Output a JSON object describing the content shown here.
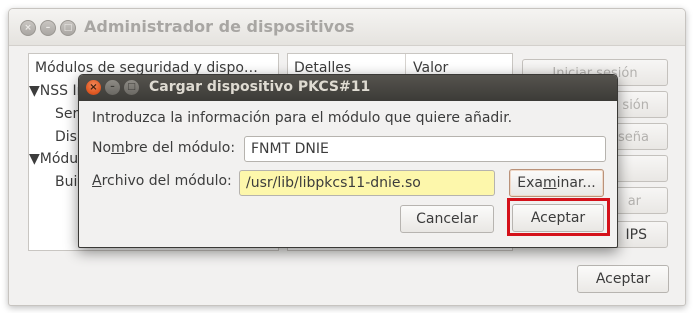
{
  "background_window": {
    "title": "Administrador de dispositivos",
    "tree_header": "Módulos de seguridad y dispo…",
    "tree_rows": [
      "▼NSS In",
      "Ser",
      "Disp",
      "▼Módul",
      "Buil"
    ],
    "details_header": "Detalles",
    "value_header": "Valor",
    "buttons": {
      "login": "Iniciar sesión",
      "logout_partial": "sión",
      "password_partial": "raseña",
      "blank1": "",
      "unload_partial": "ar",
      "fips_partial": "IPS"
    },
    "ok_button": "Aceptar"
  },
  "dialog": {
    "title": "Cargar dispositivo PKCS#11",
    "intro": "Introduzca la información para el módulo que quiere añadir.",
    "name_label_pre": "No",
    "name_label_mnemonic": "m",
    "name_label_post": "bre del módulo:",
    "name_value": "FNMT DNIE",
    "file_label_mnemonic": "A",
    "file_label_post": "rchivo del módulo:",
    "file_value": "/usr/lib/libpkcs11-dnie.so",
    "browse_pre": "Exa",
    "browse_mnemonic": "m",
    "browse_post": "inar...",
    "cancel": "Cancelar",
    "accept": "Aceptar"
  },
  "colors": {
    "highlight": "#d4111a",
    "file_field_bg": "#fdf7ab",
    "dialog_titlebar": "#3c3b37"
  }
}
